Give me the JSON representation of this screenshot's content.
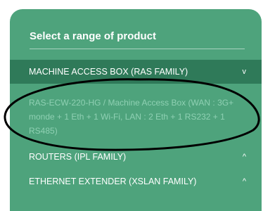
{
  "panel": {
    "title": "Select a range of product",
    "accordion": [
      {
        "label": "MACHINE ACCESS BOX (RAS FAMILY)",
        "indicator": "v",
        "expanded": true,
        "items": [
          "RAS-ECW-220-HG / Machine Access Box (WAN : 3G+ monde + 1 Eth + 1 Wi-Fi, LAN : 2 Eth + 1 RS232 + 1 RS485)"
        ]
      },
      {
        "label": "ROUTERS (IPL FAMILY)",
        "indicator": "^",
        "expanded": false
      },
      {
        "label": "ETHERNET EXTENDER (XSLAN FAMILY)",
        "indicator": "^",
        "expanded": false
      }
    ]
  },
  "colors": {
    "panel_bg": "#4ea37c",
    "active_row_bg": "#2f7a59",
    "item_text": "#8fd0b3",
    "annotation_stroke": "#000000"
  },
  "annotation": {
    "shape": "hand-drawn ellipse around expanded product item"
  }
}
